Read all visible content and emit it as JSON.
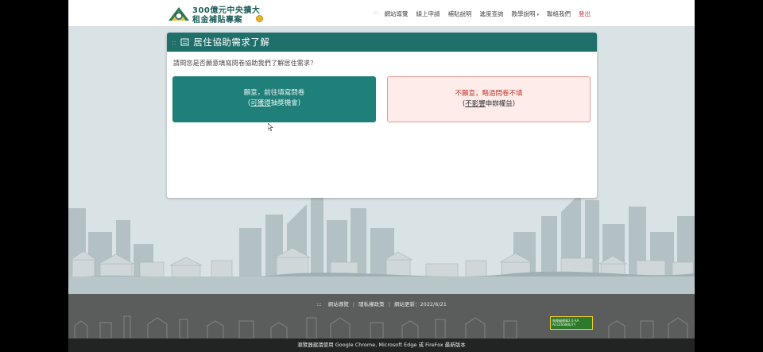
{
  "header": {
    "logo_line1": "300億元中央擴大",
    "logo_line2": "租金補貼專案",
    "nav": [
      {
        "label": "網站導覽"
      },
      {
        "label": "線上申請"
      },
      {
        "label": "補貼說明"
      },
      {
        "label": "進度查詢"
      },
      {
        "label": "教學說明"
      },
      {
        "label": "聯絡我們"
      },
      {
        "label": "登出"
      }
    ],
    "nav_caret": "▾"
  },
  "card": {
    "title": "居住協助需求了解",
    "question": "請問您是否願意填寫問卷協助我們了解居住需求？",
    "yes": {
      "line1": "願意，前往填寫問卷",
      "line2_prefix": "(",
      "line2_underline": "可獲得",
      "line2_suffix": "抽獎機會)"
    },
    "no": {
      "line1": "不願意，略過問卷不填",
      "line2_prefix": "(",
      "line2_underline": "不影響",
      "line2_suffix": "申辦權益)"
    }
  },
  "footer": {
    "links": [
      {
        "label": "網站導覽"
      },
      {
        "label": "隱私權政策"
      },
      {
        "label": "網站更新：2022/6/21"
      }
    ],
    "accessibility_label": "無障礙標章2.0 AA ACCESSIBILITY",
    "browser_note": "瀏覽器建議使用 Google Chrome, Microsoft Edge 或 FireFox 最新版本"
  },
  "colors": {
    "brand_teal": "#1f6f6b",
    "button_teal": "#1f7f79",
    "decline_bg": "#fdecea",
    "decline_border": "#e59b95",
    "decline_text": "#c0392b",
    "logout_red": "#c8363d"
  },
  "icons": [
    "logo-house-icon",
    "document-icon",
    "mouse-cursor-icon",
    "accessibility-badge-icon"
  ]
}
